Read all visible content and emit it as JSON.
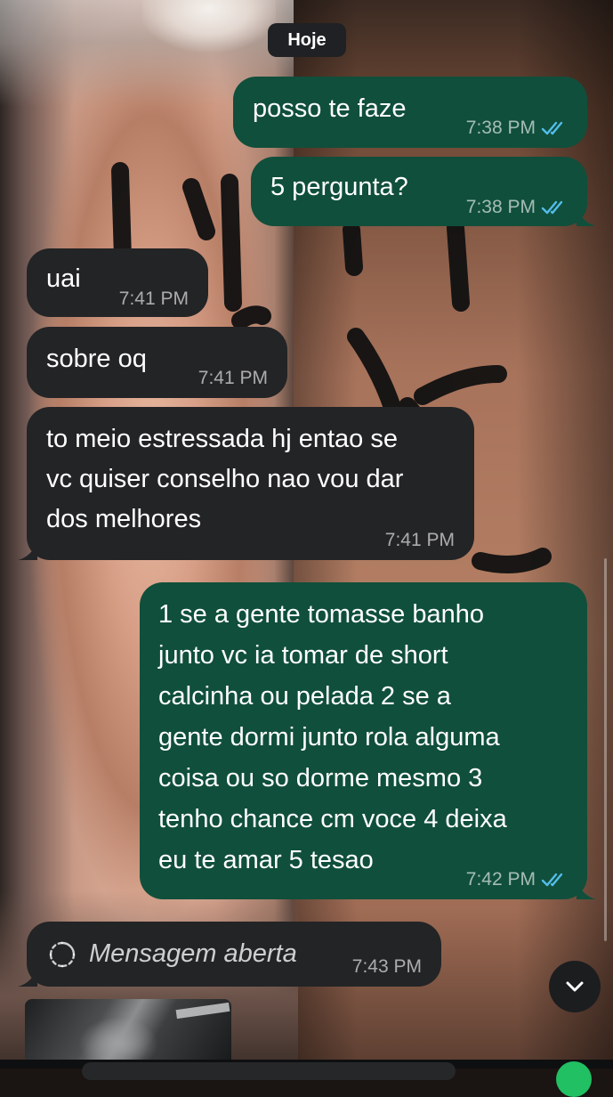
{
  "date_separator": "Hoje",
  "messages": [
    {
      "dir": "out",
      "text_lines": [
        "posso te faze"
      ],
      "time": "7:38 PM",
      "read": true
    },
    {
      "dir": "out",
      "text_lines": [
        "5 pergunta?"
      ],
      "time": "7:38 PM",
      "read": true
    },
    {
      "dir": "in",
      "text_lines": [
        "uai"
      ],
      "time": "7:41 PM"
    },
    {
      "dir": "in",
      "text_lines": [
        "sobre oq"
      ],
      "time": "7:41 PM"
    },
    {
      "dir": "in",
      "text_lines": [
        "to meio estressada hj entao se",
        "vc quiser conselho nao vou dar",
        "dos melhores"
      ],
      "time": "7:41 PM"
    },
    {
      "dir": "out",
      "text_lines": [
        "1 se a gente tomasse banho",
        "junto vc ia tomar de short",
        "calcinha ou pelada 2 se a",
        "gente dormi junto rola alguma",
        "coisa ou so dorme mesmo 3",
        "tenho chance cm voce 4 deixa",
        "eu te amar 5 tesao"
      ],
      "time": "7:42 PM",
      "read": true
    },
    {
      "dir": "in",
      "view_once": true,
      "text": "Mensagem aberta",
      "time": "7:43 PM"
    }
  ],
  "icons": {
    "read_receipt": "double-check-icon",
    "view_once": "view-once-opened-icon",
    "scroll_down": "chevron-down-icon"
  },
  "colors": {
    "outgoing_bubble": "#104f3b",
    "incoming_bubble": "#232426",
    "read_tick": "#53bdeb"
  }
}
